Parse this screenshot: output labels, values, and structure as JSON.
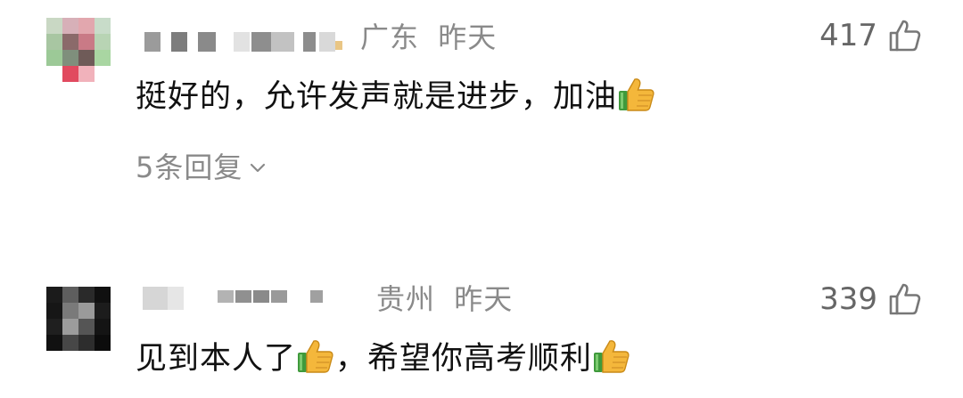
{
  "comments": [
    {
      "location": "广东",
      "time": "昨天",
      "likes": "417",
      "text_a": "挺好的，允许发声就是进步，加油",
      "replies_label": "5条回复"
    },
    {
      "location": "贵州",
      "time": "昨天",
      "likes": "339",
      "text_a": "见到本人了",
      "text_b": "，希望你高考顺利"
    }
  ],
  "icons": {
    "like": "thumbs-up-outline-icon",
    "emoji": "thumbs-up-emoji",
    "chevron": "chevron-down-icon"
  },
  "colors": {
    "muted": "#8a8a8a",
    "text": "#111111",
    "count": "#666666",
    "emoji_yellow": "#f4b73b",
    "emoji_green": "#3f9a3c"
  }
}
